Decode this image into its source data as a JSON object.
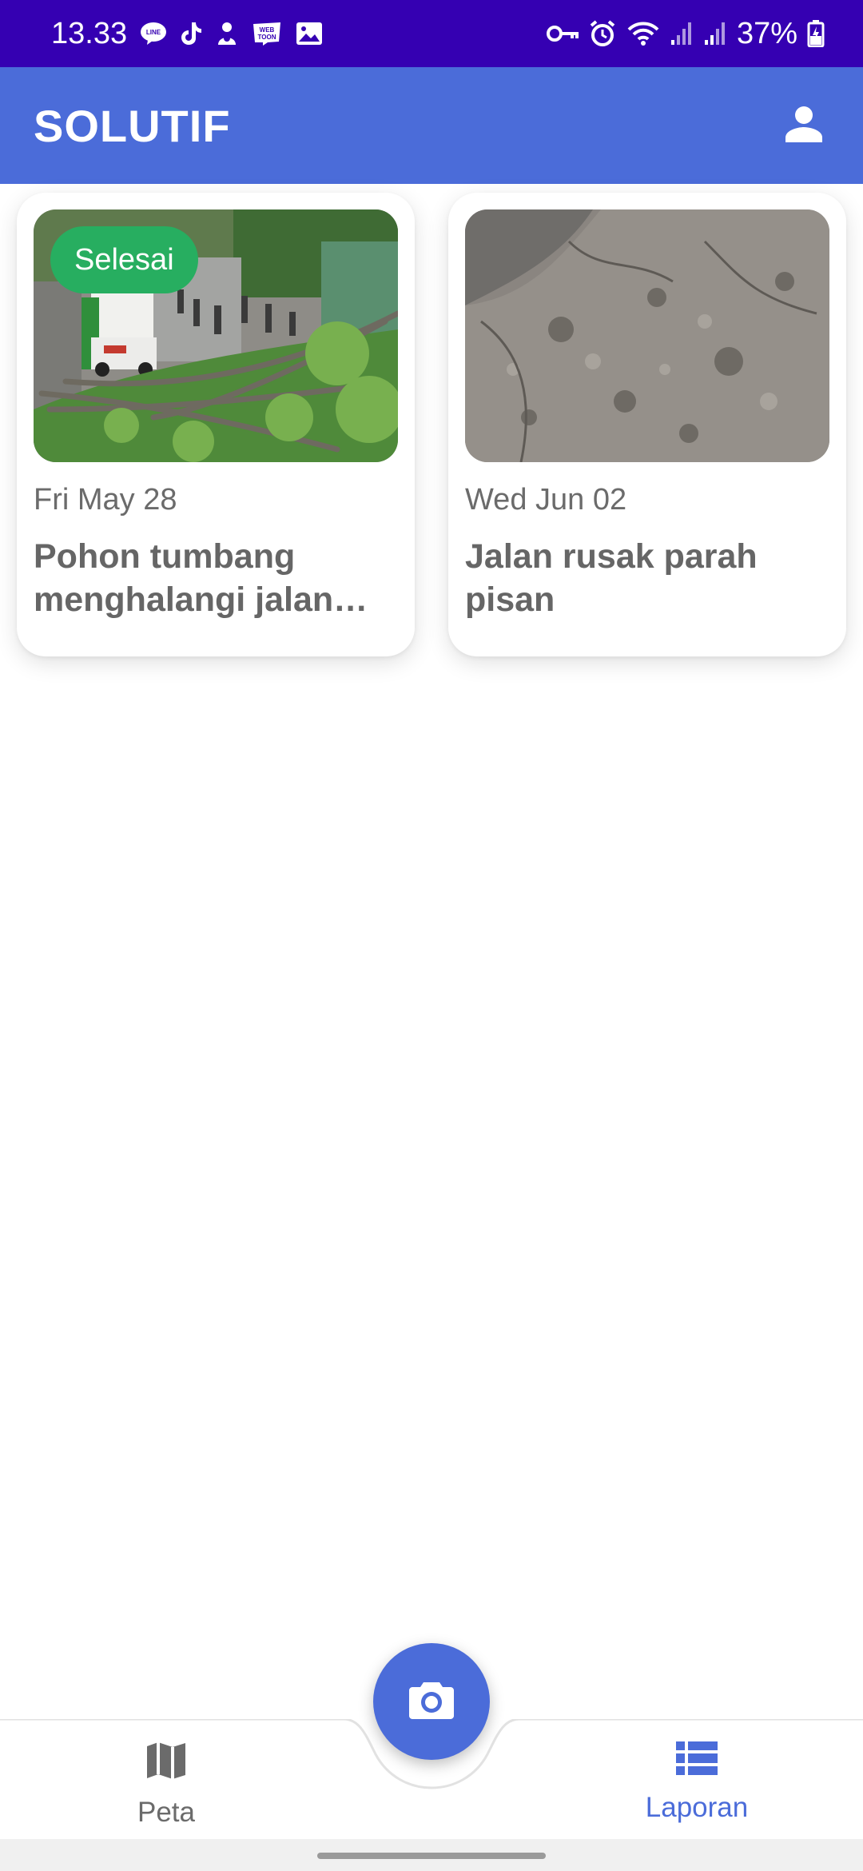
{
  "status_bar": {
    "time": "13.33",
    "battery": "37%",
    "left_icons": [
      "line-icon",
      "tiktok-icon",
      "app-icon",
      "webtoon-icon",
      "gallery-icon"
    ],
    "right_icons": [
      "vpn-key-icon",
      "alarm-icon",
      "wifi-icon",
      "signal-icon",
      "signal-icon",
      "battery-charging-icon"
    ]
  },
  "app_bar": {
    "title": "SOLUTIF",
    "profile_icon": "person-icon"
  },
  "reports": [
    {
      "badge": "Selesai",
      "date": "Fri May 28",
      "title": "Pohon tumbang menghalangi jalan d…",
      "image": "fallen-tree-on-road-photo"
    },
    {
      "date": "Wed Jun 02",
      "title": "Jalan rusak parah pisan",
      "image": "damaged-road-photo"
    }
  ],
  "bottom_nav": {
    "items": [
      {
        "label": "Peta",
        "icon": "map-icon",
        "active": false
      },
      {
        "label": "Laporan",
        "icon": "list-icon",
        "active": true
      }
    ],
    "fab_icon": "camera-icon"
  },
  "colors": {
    "status_bar": "#3500b2",
    "primary": "#4b6cd9",
    "badge_done": "#27ae60",
    "text_muted": "#6b6b6b"
  }
}
